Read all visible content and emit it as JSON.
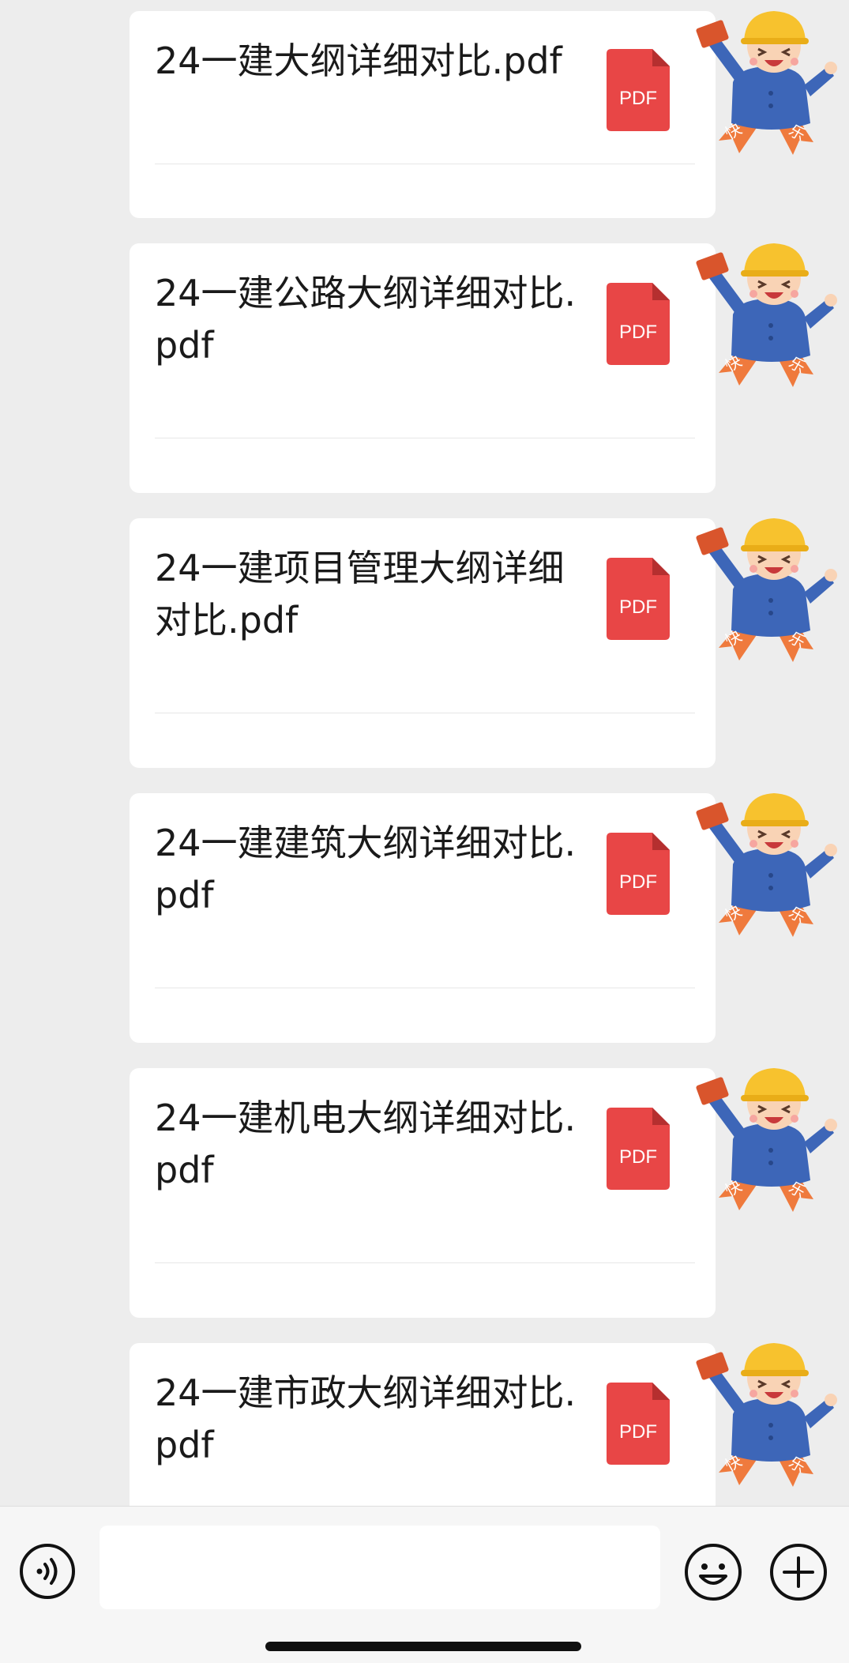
{
  "messages": [
    {
      "filename": "24一建大纲详细对比.pdf",
      "file_type": "PDF"
    },
    {
      "filename": "24一建公路大纲详细对比.pdf",
      "file_type": "PDF"
    },
    {
      "filename": "24一建项目管理大纲详细对比.pdf",
      "file_type": "PDF"
    },
    {
      "filename": "24一建建筑大纲详细对比.pdf",
      "file_type": "PDF"
    },
    {
      "filename": "24一建机电大纲详细对比.pdf",
      "file_type": "PDF"
    },
    {
      "filename": "24一建市政大纲详细对比.pdf",
      "file_type": "PDF"
    }
  ],
  "avatar": {
    "badge_left": "快",
    "badge_right": "乐"
  },
  "input_bar": {
    "input_value": "",
    "voice_icon": "voice-icon",
    "emoji_icon": "smile-icon",
    "plus_icon": "plus-icon"
  },
  "colors": {
    "pdf_red": "#e84646",
    "avatar_helmet": "#f7c22e",
    "avatar_shirt": "#3d66b8",
    "avatar_ribbon": "#ef7a3d"
  }
}
